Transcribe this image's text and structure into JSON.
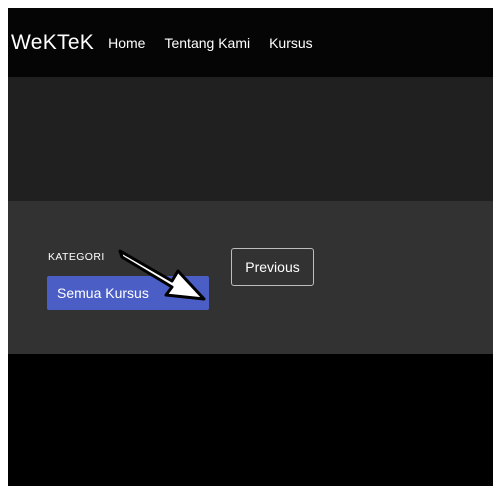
{
  "navbar": {
    "brand": "WeKTeK",
    "links": [
      "Home",
      "Tentang Kami",
      "Kursus"
    ]
  },
  "filter": {
    "heading": "KATEGORI",
    "selected_category": "Semua Kursus"
  },
  "pagination": {
    "previous_label": "Previous"
  },
  "annotation": {
    "icon": "arrow-pointer-icon"
  },
  "colors": {
    "navbar_bg": "#050505",
    "band_top_bg": "#202020",
    "band_mid_bg": "#323232",
    "accent_button": "#4b5ec6"
  }
}
